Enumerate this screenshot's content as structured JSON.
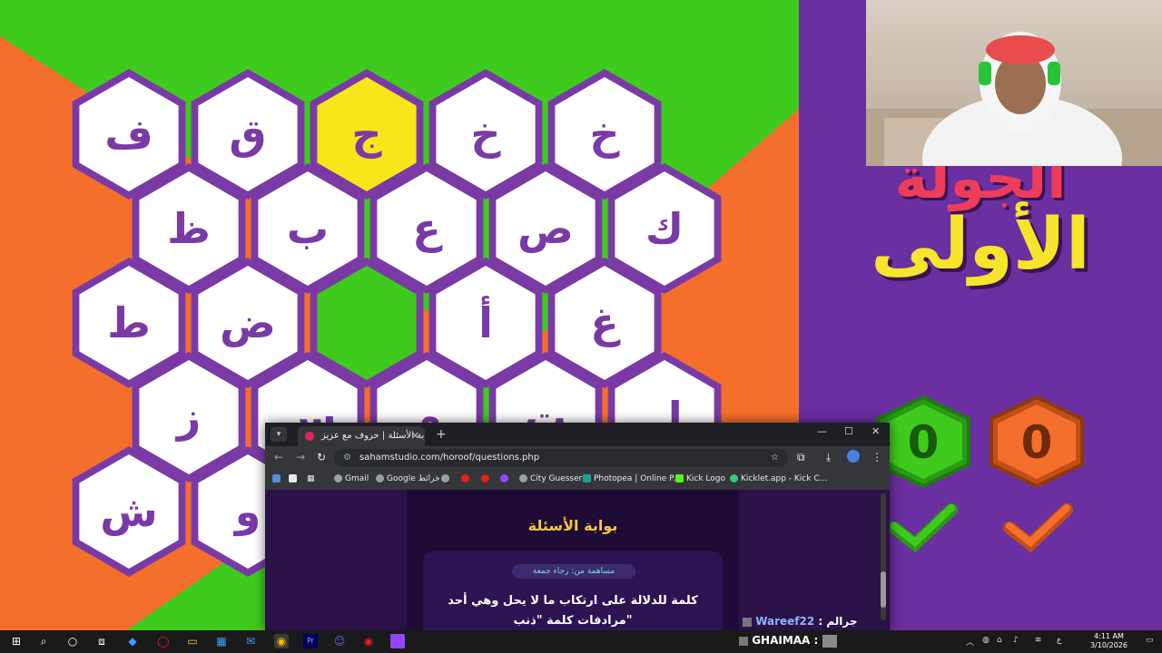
{
  "board": {
    "colors": {
      "orange": "#f46f2c",
      "green": "#3fcb1e",
      "purple": "#7a3aa6",
      "hex_white": "#ffffff",
      "hex_yellow": "#f6e61a",
      "hex_green": "#3fcb1e"
    },
    "rows": [
      [
        "ف",
        "ق",
        "ج",
        "خ",
        "خ"
      ],
      [
        "ظ",
        "ب",
        "ع",
        "ص",
        "ك"
      ],
      [
        "ط",
        "ض",
        "",
        "أ",
        "غ"
      ],
      [
        "ز",
        "س",
        "م",
        "ت",
        "ل"
      ],
      [
        "ش",
        "و",
        "",
        "",
        ""
      ]
    ],
    "highlighted": {
      "yellow": "ج"
    }
  },
  "side": {
    "round_title_line1": "الجولة",
    "round_title_line2": "الأولى",
    "score_green": "0",
    "score_orange": "0",
    "check_icon": "check-icon",
    "colors": {
      "panel": "#6a2fa0",
      "green": "#3fcb1e",
      "orange": "#f46f2c",
      "yellow": "#f7e52c",
      "red": "#ef3c5a"
    }
  },
  "browser": {
    "tab_title": "بوابة الأسئلة | حروف مع عزيز",
    "new_tab": "+",
    "url": "sahamstudio.com/horoof/questions.php",
    "bookmarks": [
      "Gmail",
      "Google خرائط",
      "City Guesser",
      "Photopea | Online P...",
      "Kick Logo",
      "Kicklet.app - Kick C..."
    ],
    "page_title": "بوابة الأسئلة",
    "contributor": "مساهمة من: رجاء جمعة",
    "question_line1": "كلمة للدلالة على ارتكاب ما لا يحل وهي أحد",
    "question_line2": "مرادفات كلمة \"ذنب\""
  },
  "chat": {
    "user1": "Wareef22",
    "msg1": ": جرالم",
    "user2": "GHAIMAA",
    "msg2": ":"
  },
  "taskbar": {
    "time": "4:11 AM",
    "date": "3/10/2026",
    "lang": "ع"
  }
}
